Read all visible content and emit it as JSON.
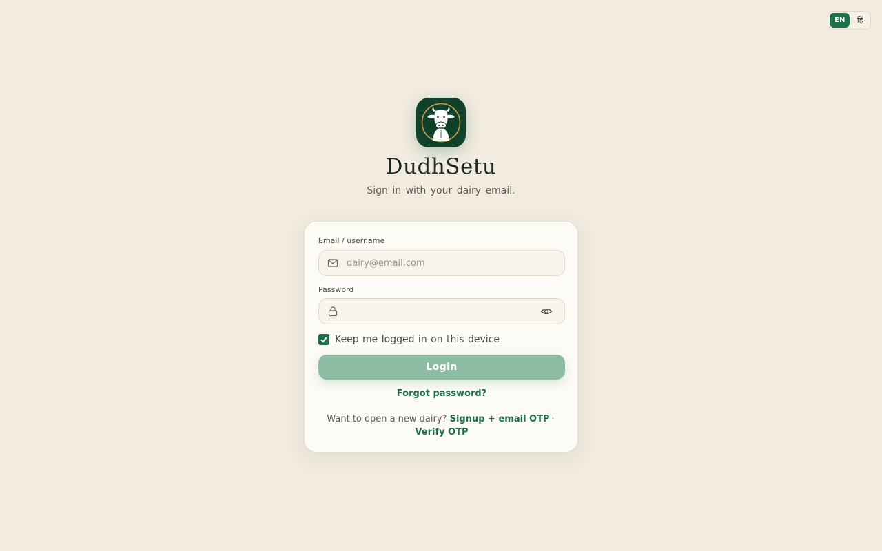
{
  "language_toggle": {
    "options": [
      "EN",
      "हिं"
    ],
    "selected": "EN"
  },
  "brand": {
    "app_name": "DudhSetu",
    "tagline": "Sign in with your dairy email.",
    "logo_icon": "cow-logo-icon"
  },
  "form": {
    "email": {
      "label": "Email / username",
      "placeholder": "dairy@email.com",
      "value": "",
      "icon": "mail-icon"
    },
    "password": {
      "label": "Password",
      "value": "",
      "icon": "lock-icon",
      "toggle_icon": "eye-icon"
    },
    "remember_me": {
      "label": "Keep me logged in on this device",
      "checked": true
    },
    "login_label": "Login",
    "forgot_label": "Forgot password?"
  },
  "footer": {
    "prompt": "Want to open a new dairy?",
    "signup_label": "Signup + email OTP",
    "separator": "·",
    "verify_label": "Verify OTP"
  },
  "colors": {
    "accent": "#1d7049",
    "logo_bg": "#10412a",
    "page_bg": "#f1ebe0",
    "button_disabled": "#8cbba3"
  }
}
